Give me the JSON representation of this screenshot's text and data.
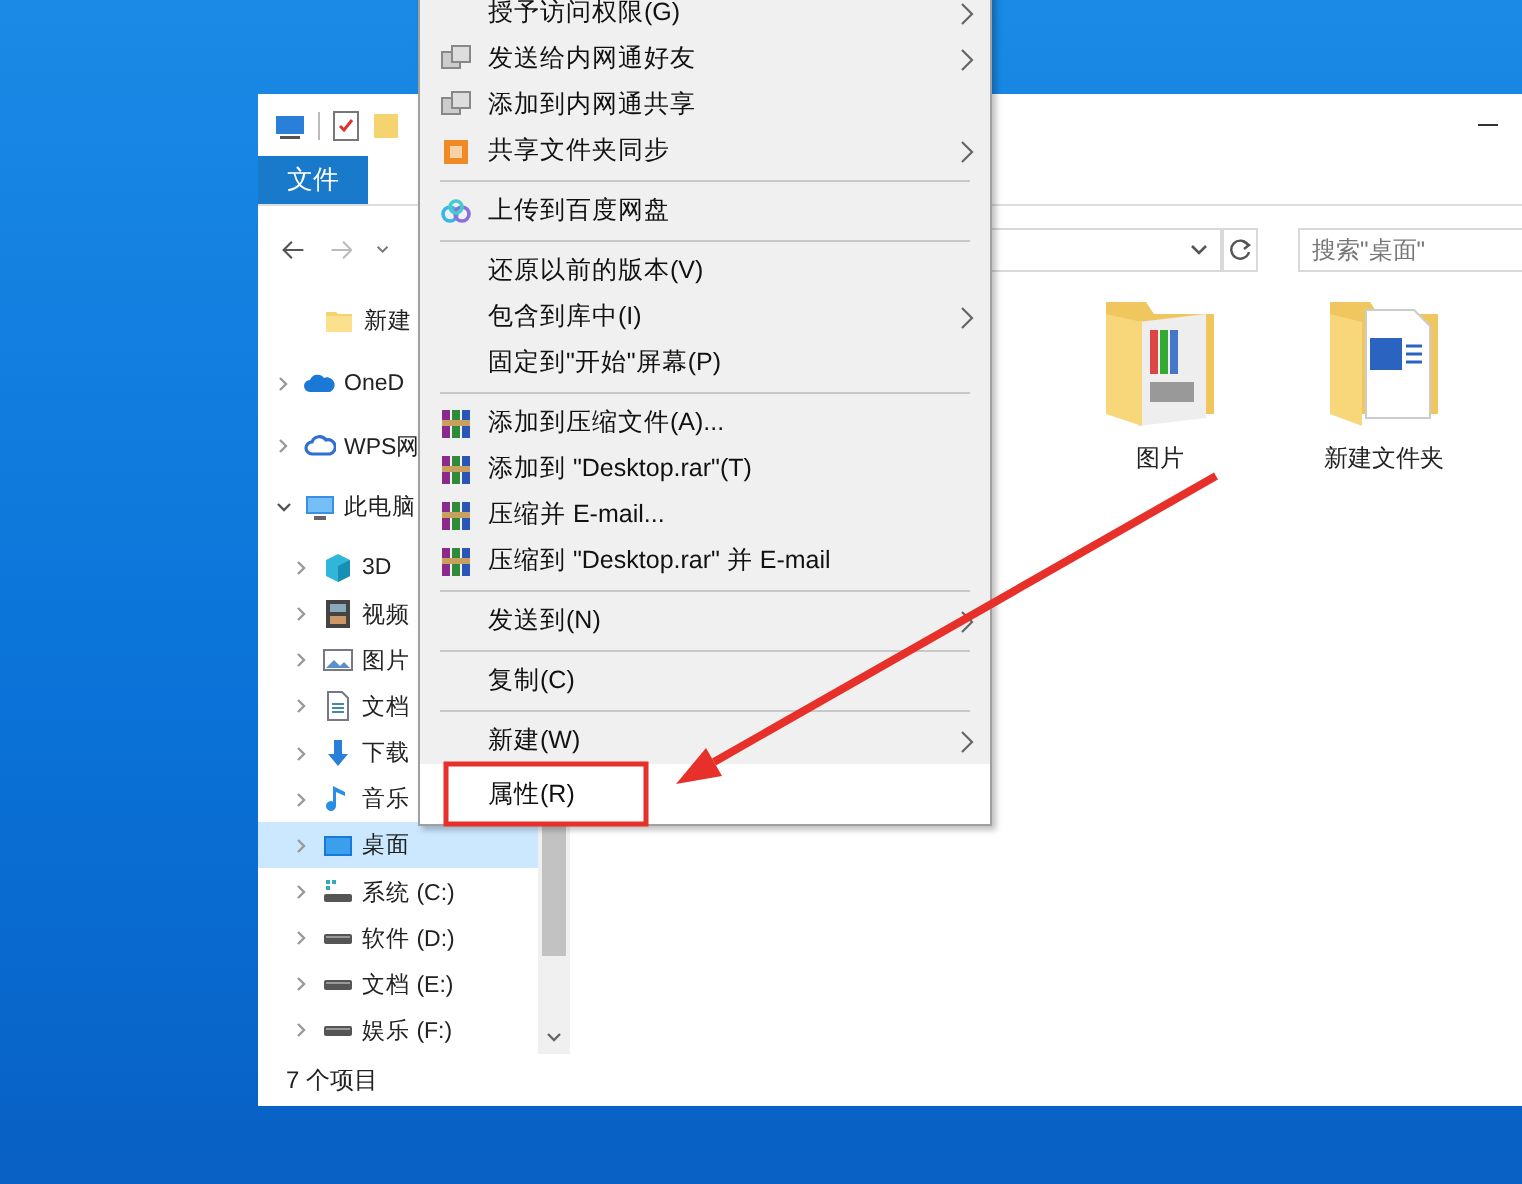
{
  "window": {
    "ribbon_tabs": [
      {
        "label": "文件",
        "selected": true
      }
    ],
    "search": {
      "placeholder": "搜索\"桌面\""
    },
    "quick_access": [
      {
        "label": "新建"
      }
    ],
    "nav_items": [
      {
        "label": "OneD",
        "kind": "cloud",
        "expanded": false,
        "selected": false
      },
      {
        "label": "WPS网",
        "kind": "cloud-outline",
        "expanded": false,
        "selected": false
      },
      {
        "label": "此电脑",
        "kind": "pc",
        "expanded": true,
        "selected": false,
        "children": [
          {
            "label": "3D",
            "kind": "cube",
            "expanded": false,
            "selected": false
          },
          {
            "label": "视频",
            "kind": "film",
            "expanded": false,
            "selected": false
          },
          {
            "label": "图片",
            "kind": "picture",
            "expanded": false,
            "selected": false
          },
          {
            "label": "文档",
            "kind": "doc",
            "expanded": false,
            "selected": false
          },
          {
            "label": "下载",
            "kind": "download",
            "expanded": false,
            "selected": false
          },
          {
            "label": "音乐",
            "kind": "music",
            "expanded": false,
            "selected": false
          },
          {
            "label": "桌面",
            "kind": "desktop",
            "expanded": false,
            "selected": true
          },
          {
            "label": "系统 (C:)",
            "kind": "system-drive",
            "expanded": false,
            "selected": false
          },
          {
            "label": "软件 (D:)",
            "kind": "drive",
            "expanded": false,
            "selected": false
          },
          {
            "label": "文档 (E:)",
            "kind": "drive",
            "expanded": false,
            "selected": false
          },
          {
            "label": "娱乐 (F:)",
            "kind": "drive",
            "expanded": false,
            "selected": false
          }
        ]
      }
    ],
    "files": [
      {
        "label": "图片",
        "kind": "photo-folder"
      },
      {
        "label": "新建文件夹",
        "kind": "word-folder"
      }
    ],
    "status_bar": "7 个项目"
  },
  "context_menu": [
    {
      "kind": "plain",
      "label": "授予访问权限(G)",
      "submenu": true,
      "highlighted": false
    },
    {
      "kind": "netpass",
      "label": "发送给内网通好友",
      "submenu": true,
      "highlighted": false
    },
    {
      "kind": "netpass",
      "label": "添加到内网通共享",
      "submenu": false,
      "highlighted": false
    },
    {
      "kind": "sync",
      "label": "共享文件夹同步",
      "submenu": true,
      "highlighted": false
    },
    {
      "kind": "separator"
    },
    {
      "kind": "cloud",
      "label": "上传到百度网盘",
      "submenu": false,
      "highlighted": false
    },
    {
      "kind": "separator"
    },
    {
      "kind": "plain",
      "label": "还原以前的版本(V)",
      "submenu": false,
      "highlighted": false
    },
    {
      "kind": "plain",
      "label": "包含到库中(I)",
      "submenu": true,
      "highlighted": false
    },
    {
      "kind": "plain",
      "label": "固定到\"开始\"屏幕(P)",
      "submenu": false,
      "highlighted": false
    },
    {
      "kind": "separator"
    },
    {
      "kind": "archive",
      "label": "添加到压缩文件(A)...",
      "submenu": false,
      "highlighted": false
    },
    {
      "kind": "archive",
      "label": "添加到 \"Desktop.rar\"(T)",
      "submenu": false,
      "highlighted": false
    },
    {
      "kind": "archive",
      "label": "压缩并 E-mail...",
      "submenu": false,
      "highlighted": false
    },
    {
      "kind": "archive",
      "label": "压缩到 \"Desktop.rar\" 并 E-mail",
      "submenu": false,
      "highlighted": false
    },
    {
      "kind": "separator"
    },
    {
      "kind": "plain",
      "label": "发送到(N)",
      "submenu": true,
      "highlighted": false
    },
    {
      "kind": "separator"
    },
    {
      "kind": "plain",
      "label": "复制(C)",
      "submenu": false,
      "highlighted": false
    },
    {
      "kind": "separator"
    },
    {
      "kind": "plain",
      "label": "新建(W)",
      "submenu": true,
      "highlighted": false
    },
    {
      "kind": "plain",
      "label": "属性(R)",
      "submenu": false,
      "highlighted": true
    }
  ],
  "annotation": {
    "color": "#e8302a"
  }
}
